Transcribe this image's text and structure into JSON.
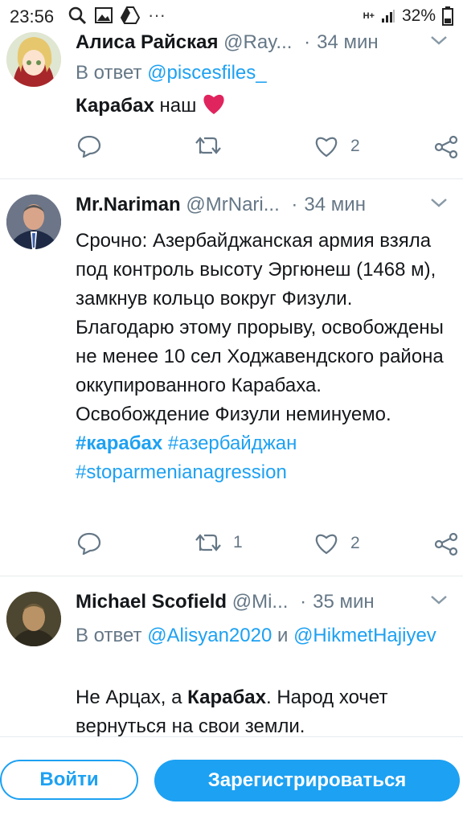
{
  "status_bar": {
    "time": "23:56",
    "network": "H+",
    "battery": "32%",
    "more": "···"
  },
  "tweets": [
    {
      "name": "Алиса Райская",
      "handle": "@Ray...",
      "time": "34 мин",
      "reply_label": "В ответ",
      "reply_to_1": "@piscesfiles_",
      "text_bold": "Карабах",
      "text_rest": " наш",
      "emoji": "heart",
      "retweets": "",
      "likes": "2"
    },
    {
      "name": "Mr.Nariman",
      "handle": "@MrNari...",
      "time": "34 мин",
      "text": "Срочно: Азербайджанская армия взяла под контроль высоту Эргюнеш (1468 м), замкнув кольцо вокруг Физули. Благодарю этому прорыву, освобождены не менее 10 сел Ходжавендского района оккупированного Карабаха. Освобождение Физули неминуемо.",
      "hashtag_1": "#карабах",
      "hashtag_2": "#азербайджан",
      "hashtag_3": "#stoparmenianagression",
      "retweets": "1",
      "likes": "2"
    },
    {
      "name": "Michael Scofield",
      "handle": "@Mi...",
      "time": "35 мин",
      "reply_label": "В ответ",
      "reply_to_1": "@Alisyan2020",
      "reply_and": "и",
      "reply_to_2": "@HikmetHajiyev",
      "text_pre": "Не Арцах, а ",
      "text_bold": "Карабах",
      "text_rest": ". Народ хочет вернуться на свои земли."
    }
  ],
  "bottom": {
    "login": "Войти",
    "signup": "Зарегистрироваться"
  },
  "colors": {
    "accent": "#1da1f2",
    "muted": "#657786",
    "like": "#e0245e"
  }
}
